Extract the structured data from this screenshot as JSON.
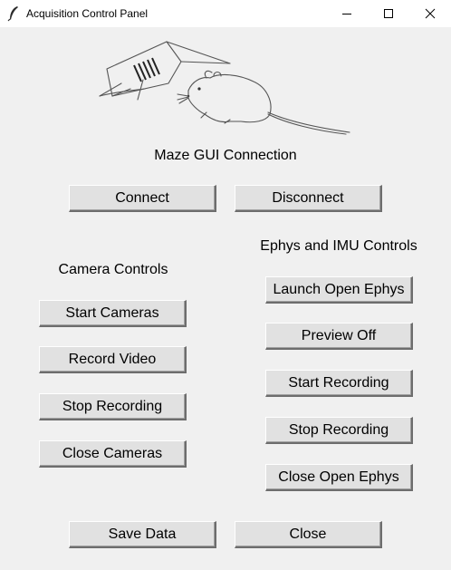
{
  "window": {
    "title": "Acquisition Control Panel"
  },
  "maze": {
    "heading": "Maze GUI Connection",
    "connect_label": "Connect",
    "disconnect_label": "Disconnect"
  },
  "camera": {
    "heading": "Camera Controls",
    "start_label": "Start Cameras",
    "record_label": "Record Video",
    "stop_label": "Stop Recording",
    "close_label": "Close Cameras"
  },
  "ephys": {
    "heading": "Ephys and IMU Controls",
    "launch_label": "Launch Open Ephys",
    "preview_label": "Preview Off",
    "start_label": "Start Recording",
    "stop_label": "Stop Recording",
    "close_label": "Close Open Ephys"
  },
  "footer": {
    "save_label": "Save Data",
    "close_label": "Close"
  }
}
